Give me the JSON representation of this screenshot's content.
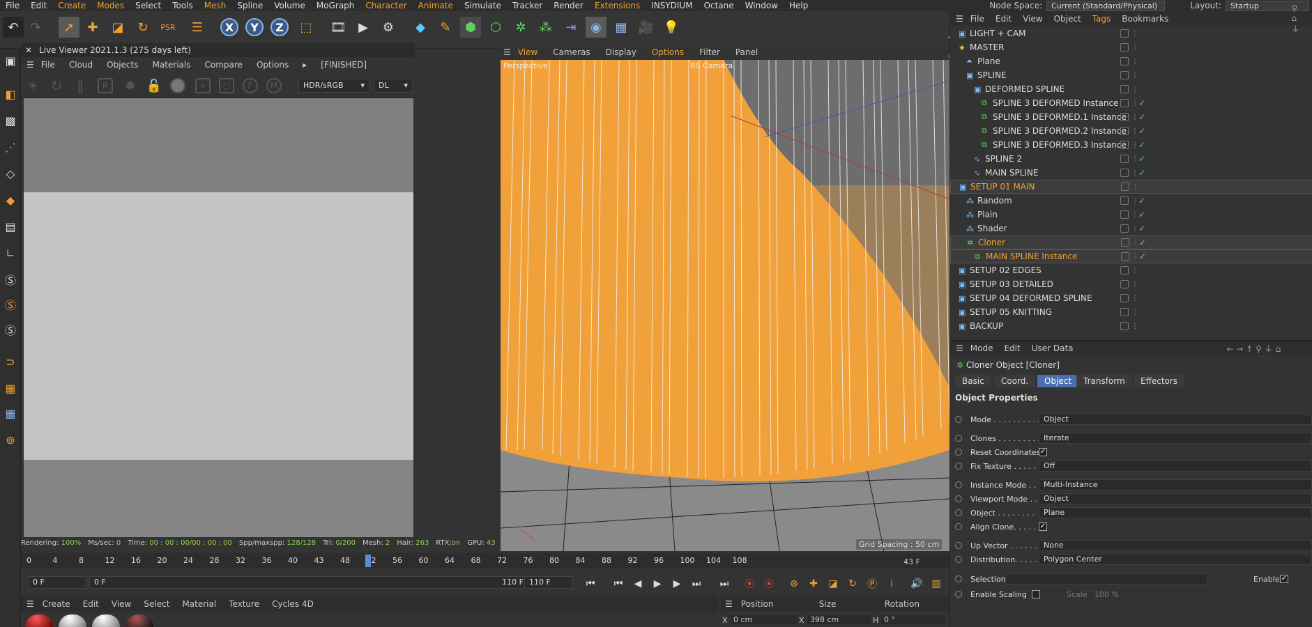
{
  "menubar": {
    "items": [
      "File",
      "Edit",
      "Create",
      "Modes",
      "Select",
      "Tools",
      "Mesh",
      "Spline",
      "Volume",
      "MoGraph",
      "Character",
      "Animate",
      "Simulate",
      "Tracker",
      "Render",
      "Extensions",
      "INSYDIUM",
      "Octane",
      "Window",
      "Help"
    ],
    "node_space_label": "Node Space:",
    "node_space_value": "Current (Standard/Physical)",
    "layout_label": "Layout:",
    "layout_value": "Startup"
  },
  "live_viewer": {
    "title": "Live Viewer 2021.1.3 (275 days left)",
    "menu": [
      "File",
      "Cloud",
      "Objects",
      "Materials",
      "Compare",
      "Options"
    ],
    "status_tag": "[FINISHED]",
    "color_mode": "HDR/sRGB",
    "render_mode": "DL"
  },
  "render_status": {
    "rendering": "Rendering:",
    "rendering_val": "100%",
    "ms_sec": "Ms/sec:",
    "ms_sec_val": "0",
    "time": "Time:",
    "time_val": "00 : 00 : 00/00 : 00 : 00",
    "spp": "Spp/maxspp:",
    "spp_val": "128/128",
    "tri": "Tri:",
    "tri_val": "0/200",
    "mesh": "Mesh:",
    "mesh_val": "2",
    "hair": "Hair:",
    "hair_val": "263",
    "rtx": "RTX:",
    "rtx_val": "on",
    "gpu": "GPU:",
    "gpu_val": "43"
  },
  "viewport": {
    "menu": [
      "View",
      "Cameras",
      "Display",
      "Options",
      "Filter",
      "Panel"
    ],
    "label": "Perspective",
    "camera": "RS Camera",
    "grid_spacing": "Grid Spacing : 50 cm"
  },
  "timeline": {
    "ticks": [
      "0",
      "4",
      "8",
      "12",
      "16",
      "20",
      "24",
      "28",
      "32",
      "36",
      "40",
      "43",
      "48",
      "52",
      "56",
      "60",
      "64",
      "68",
      "72",
      "76",
      "80",
      "84",
      "88",
      "92",
      "96",
      "100",
      "104",
      "108"
    ],
    "current_frame": "43 F",
    "start": "0 F",
    "start2": "0 F",
    "end": "110 F",
    "end2": "110 F"
  },
  "material_bar": {
    "menu": [
      "Create",
      "Edit",
      "View",
      "Select",
      "Material",
      "Texture",
      "Cycles 4D"
    ]
  },
  "coords": {
    "headers": [
      "Position",
      "Size",
      "Rotation"
    ],
    "x_label": "X",
    "x_pos": "0 cm",
    "x_label2": "X",
    "x_size": "398 cm",
    "h_label": "H",
    "h_rot": "0 °"
  },
  "object_manager": {
    "menu": [
      "File",
      "Edit",
      "View",
      "Object",
      "Tags",
      "Bookmarks"
    ],
    "rows": [
      {
        "name": "LIGHT + CAM",
        "indent": 0,
        "icon": "layer"
      },
      {
        "name": "MASTER",
        "indent": 0,
        "icon": "star"
      },
      {
        "name": "Plane",
        "indent": 1,
        "icon": "plane"
      },
      {
        "name": "SPLINE",
        "indent": 1,
        "icon": "layer"
      },
      {
        "name": "DEFORMED SPLINE",
        "indent": 2,
        "icon": "layer"
      },
      {
        "name": "SPLINE 3 DEFORMED Instance",
        "indent": 3,
        "icon": "instance"
      },
      {
        "name": "SPLINE 3 DEFORMED.1 Instance",
        "indent": 3,
        "icon": "instance"
      },
      {
        "name": "SPLINE 3 DEFORMED.2 Instance",
        "indent": 3,
        "icon": "instance"
      },
      {
        "name": "SPLINE 3 DEFORMED.3 Instance",
        "indent": 3,
        "icon": "instance"
      },
      {
        "name": "SPLINE 2",
        "indent": 2,
        "icon": "spline"
      },
      {
        "name": "MAIN SPLINE",
        "indent": 2,
        "icon": "spline"
      },
      {
        "name": "SETUP 01 MAIN",
        "indent": 0,
        "icon": "layer",
        "sel": true
      },
      {
        "name": "Random",
        "indent": 1,
        "icon": "effector"
      },
      {
        "name": "Plain",
        "indent": 1,
        "icon": "effector"
      },
      {
        "name": "Shader",
        "indent": 1,
        "icon": "effector"
      },
      {
        "name": "Cloner",
        "indent": 1,
        "icon": "cloner",
        "sel": true
      },
      {
        "name": "MAIN SPLINE Instance",
        "indent": 2,
        "icon": "instance",
        "sel": true
      },
      {
        "name": "SETUP 02 EDGES",
        "indent": 0,
        "icon": "layer"
      },
      {
        "name": "SETUP 03 DETAILED",
        "indent": 0,
        "icon": "layer"
      },
      {
        "name": "SETUP 04 DEFORMED SPLINE",
        "indent": 0,
        "icon": "layer"
      },
      {
        "name": "SETUP 05 KNITTING",
        "indent": 0,
        "icon": "layer"
      },
      {
        "name": "BACKUP",
        "indent": 0,
        "icon": "layer"
      }
    ]
  },
  "attributes": {
    "menu": [
      "Mode",
      "Edit",
      "User Data"
    ],
    "object_title": "Cloner Object [Cloner]",
    "tabs": [
      "Basic",
      "Coord.",
      "Object",
      "Transform",
      "Effectors"
    ],
    "active_tab": "Object",
    "section": "Object Properties",
    "fields": [
      {
        "label": "Mode . . . . . . . . . .",
        "value": "Object"
      },
      {
        "label": "Clones . . . . . . . . .",
        "value": "Iterate"
      },
      {
        "label": "Reset Coordinates",
        "value": ""
      },
      {
        "label": "Fix Texture . . . . . .",
        "value": "Off"
      },
      {
        "label": "Instance Mode . . . .",
        "value": "Multi-Instance"
      },
      {
        "label": "Viewport Mode . . .",
        "value": "Object"
      },
      {
        "label": "Object . . . . . . . .",
        "value": "Plane"
      },
      {
        "label": "Align Clone. . . . . .",
        "value": ""
      },
      {
        "label": "Up Vector . . . . . .",
        "value": "None"
      },
      {
        "label": "Distribution. . . . . .",
        "value": "Polygon Center"
      },
      {
        "label": "Selection",
        "value": ""
      },
      {
        "label": "Enable Scaling",
        "value": ""
      }
    ],
    "enable_label": "Enable",
    "scale_label": "Scale",
    "scale_value": "100 %"
  },
  "colors": {
    "accent": "#f0a030",
    "selected_tab": "#4a6fb0",
    "orange_hair": "#f2a13a"
  }
}
